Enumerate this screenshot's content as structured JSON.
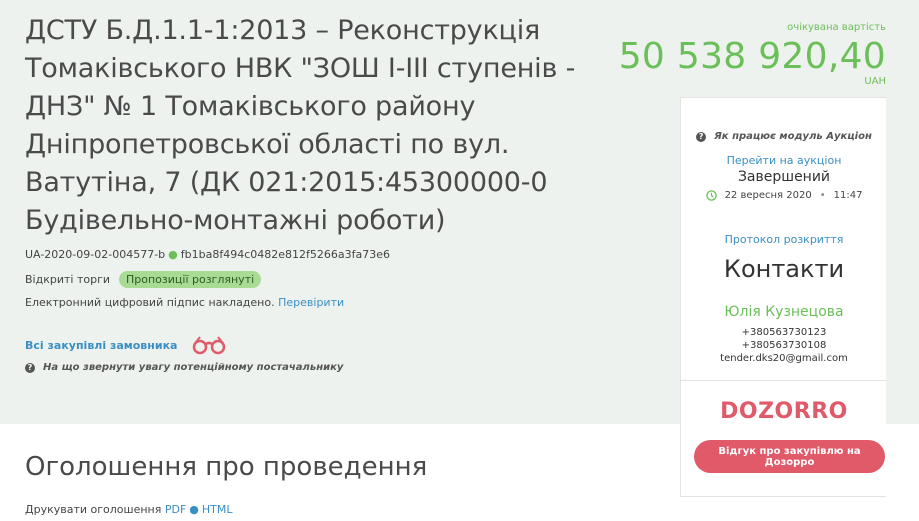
{
  "tender": {
    "title": "ДСТУ Б.Д.1.1-1:2013 – Реконструкція Томаківського НВК \"ЗОШ І-ІІІ ступенів - ДНЗ\" № 1 Томаківського району Дніпропетровської області по вул. Ватутіна, 7 (ДК 021:2015:45300000-0 Будівельно-монтажні роботи)",
    "id": "UA-2020-09-02-004577-b",
    "hash": "fb1ba8f494c0482e812f5266a3fa73e6",
    "procedure": "Відкриті торги",
    "status_badge": "Пропозиції розглянуті",
    "signature_text": "Електронний цифровий підпис накладено.",
    "signature_link": "Перевірити",
    "all_purchases_link": "Всі закупівлі замовника",
    "attention_text": "На що звернути увагу потенційному постачальнику",
    "expected_value_label": "очікувана вартість",
    "expected_value": "50 538 920,40",
    "currency": "UAH"
  },
  "auction": {
    "howto_text": "Як працює модуль Аукціон",
    "goto_link": "Перейти на аукціон",
    "status": "Завершений",
    "date": "22 вересня 2020",
    "time": "11:47",
    "protocol_link": "Протокол розкриття"
  },
  "contacts": {
    "title": "Контакти",
    "name": "Юлія Кузнецова",
    "phone1": "+380563730123",
    "phone2": "+380563730108",
    "email": "tender.dks20@gmail.com"
  },
  "dozorro": {
    "logo_text": "DOZORRO",
    "review_button": "Відгук про закупівлю на Дозорро"
  },
  "announcement": {
    "title": "Оголошення про проведення",
    "print_label": "Друкувати оголошення",
    "pdf_link": "PDF",
    "html_link": "HTML"
  },
  "colors": {
    "accent_green": "#6bbf59",
    "link_blue": "#3a8fc4",
    "dozorro_red": "#e05a6a",
    "hero_bg": "#edf2ee"
  },
  "icons": {
    "binoculars": "binoculars-icon",
    "question": "question-circle-icon",
    "clock": "clock-icon"
  }
}
